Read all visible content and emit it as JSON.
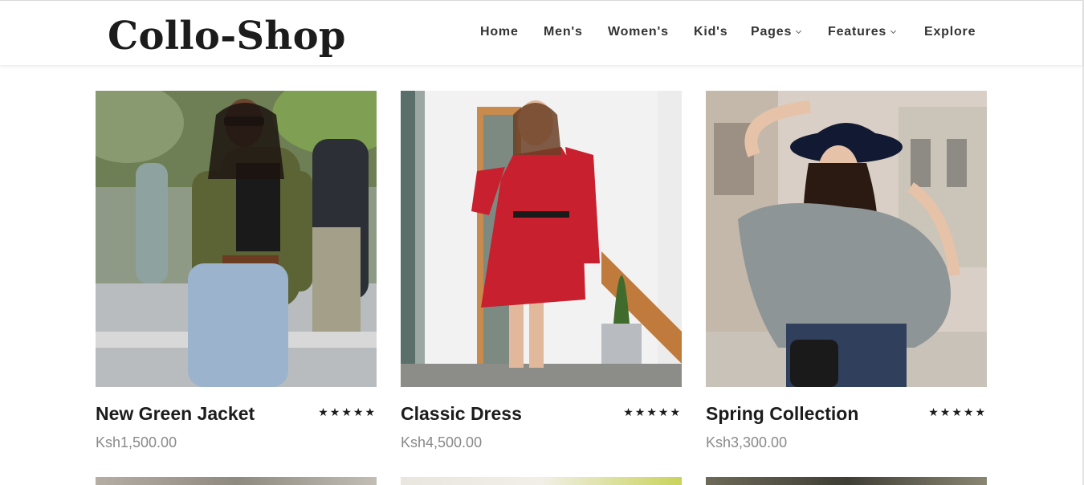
{
  "brand": {
    "name": "Collo-Shop"
  },
  "nav": {
    "home": "Home",
    "mens": "Men's",
    "womens": "Women's",
    "kids": "Kid's",
    "pages": "Pages",
    "features": "Features",
    "explore": "Explore"
  },
  "products": [
    {
      "name": "New Green Jacket",
      "price": "Ksh1,500.00",
      "rating": "★★★★★"
    },
    {
      "name": "Classic Dress",
      "price": "Ksh4,500.00",
      "rating": "★★★★★"
    },
    {
      "name": "Spring Collection",
      "price": "Ksh3,300.00",
      "rating": "★★★★★"
    }
  ]
}
